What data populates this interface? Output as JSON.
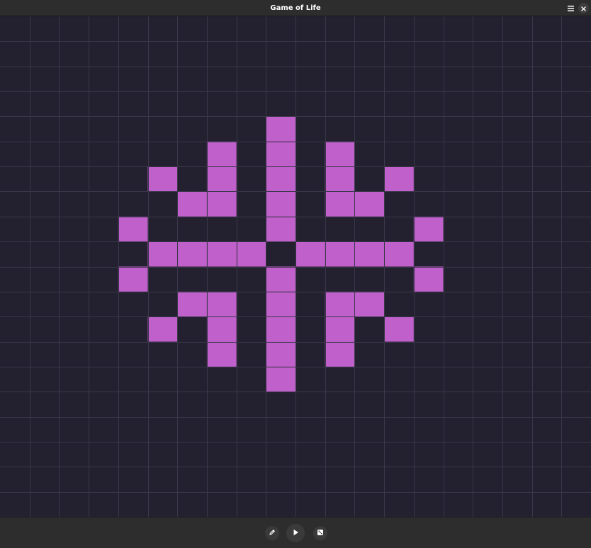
{
  "window": {
    "title": "Game of Life"
  },
  "header": {
    "menu_icon": "hamburger-menu-icon",
    "close_icon": "close-icon"
  },
  "board": {
    "columns": 20,
    "rows": 20,
    "background_color": "#23202f",
    "grid_line_color": "#3a374a",
    "live_cell_color": "#c061cb",
    "live_cells": [
      [
        9,
        4
      ],
      [
        7,
        5
      ],
      [
        9,
        5
      ],
      [
        11,
        5
      ],
      [
        5,
        6
      ],
      [
        7,
        6
      ],
      [
        9,
        6
      ],
      [
        11,
        6
      ],
      [
        13,
        6
      ],
      [
        6,
        7
      ],
      [
        7,
        7
      ],
      [
        9,
        7
      ],
      [
        11,
        7
      ],
      [
        12,
        7
      ],
      [
        4,
        8
      ],
      [
        9,
        8
      ],
      [
        14,
        8
      ],
      [
        5,
        9
      ],
      [
        6,
        9
      ],
      [
        7,
        9
      ],
      [
        8,
        9
      ],
      [
        10,
        9
      ],
      [
        11,
        9
      ],
      [
        12,
        9
      ],
      [
        13,
        9
      ],
      [
        4,
        10
      ],
      [
        9,
        10
      ],
      [
        14,
        10
      ],
      [
        6,
        11
      ],
      [
        7,
        11
      ],
      [
        9,
        11
      ],
      [
        11,
        11
      ],
      [
        12,
        11
      ],
      [
        5,
        12
      ],
      [
        7,
        12
      ],
      [
        9,
        12
      ],
      [
        11,
        12
      ],
      [
        13,
        12
      ],
      [
        7,
        13
      ],
      [
        9,
        13
      ],
      [
        11,
        13
      ],
      [
        9,
        14
      ]
    ]
  },
  "toolbar": {
    "buttons": [
      {
        "name": "edit-button",
        "icon": "pencil-icon"
      },
      {
        "name": "play-button",
        "icon": "play-icon"
      },
      {
        "name": "randomize-button",
        "icon": "dice-icon"
      }
    ]
  }
}
